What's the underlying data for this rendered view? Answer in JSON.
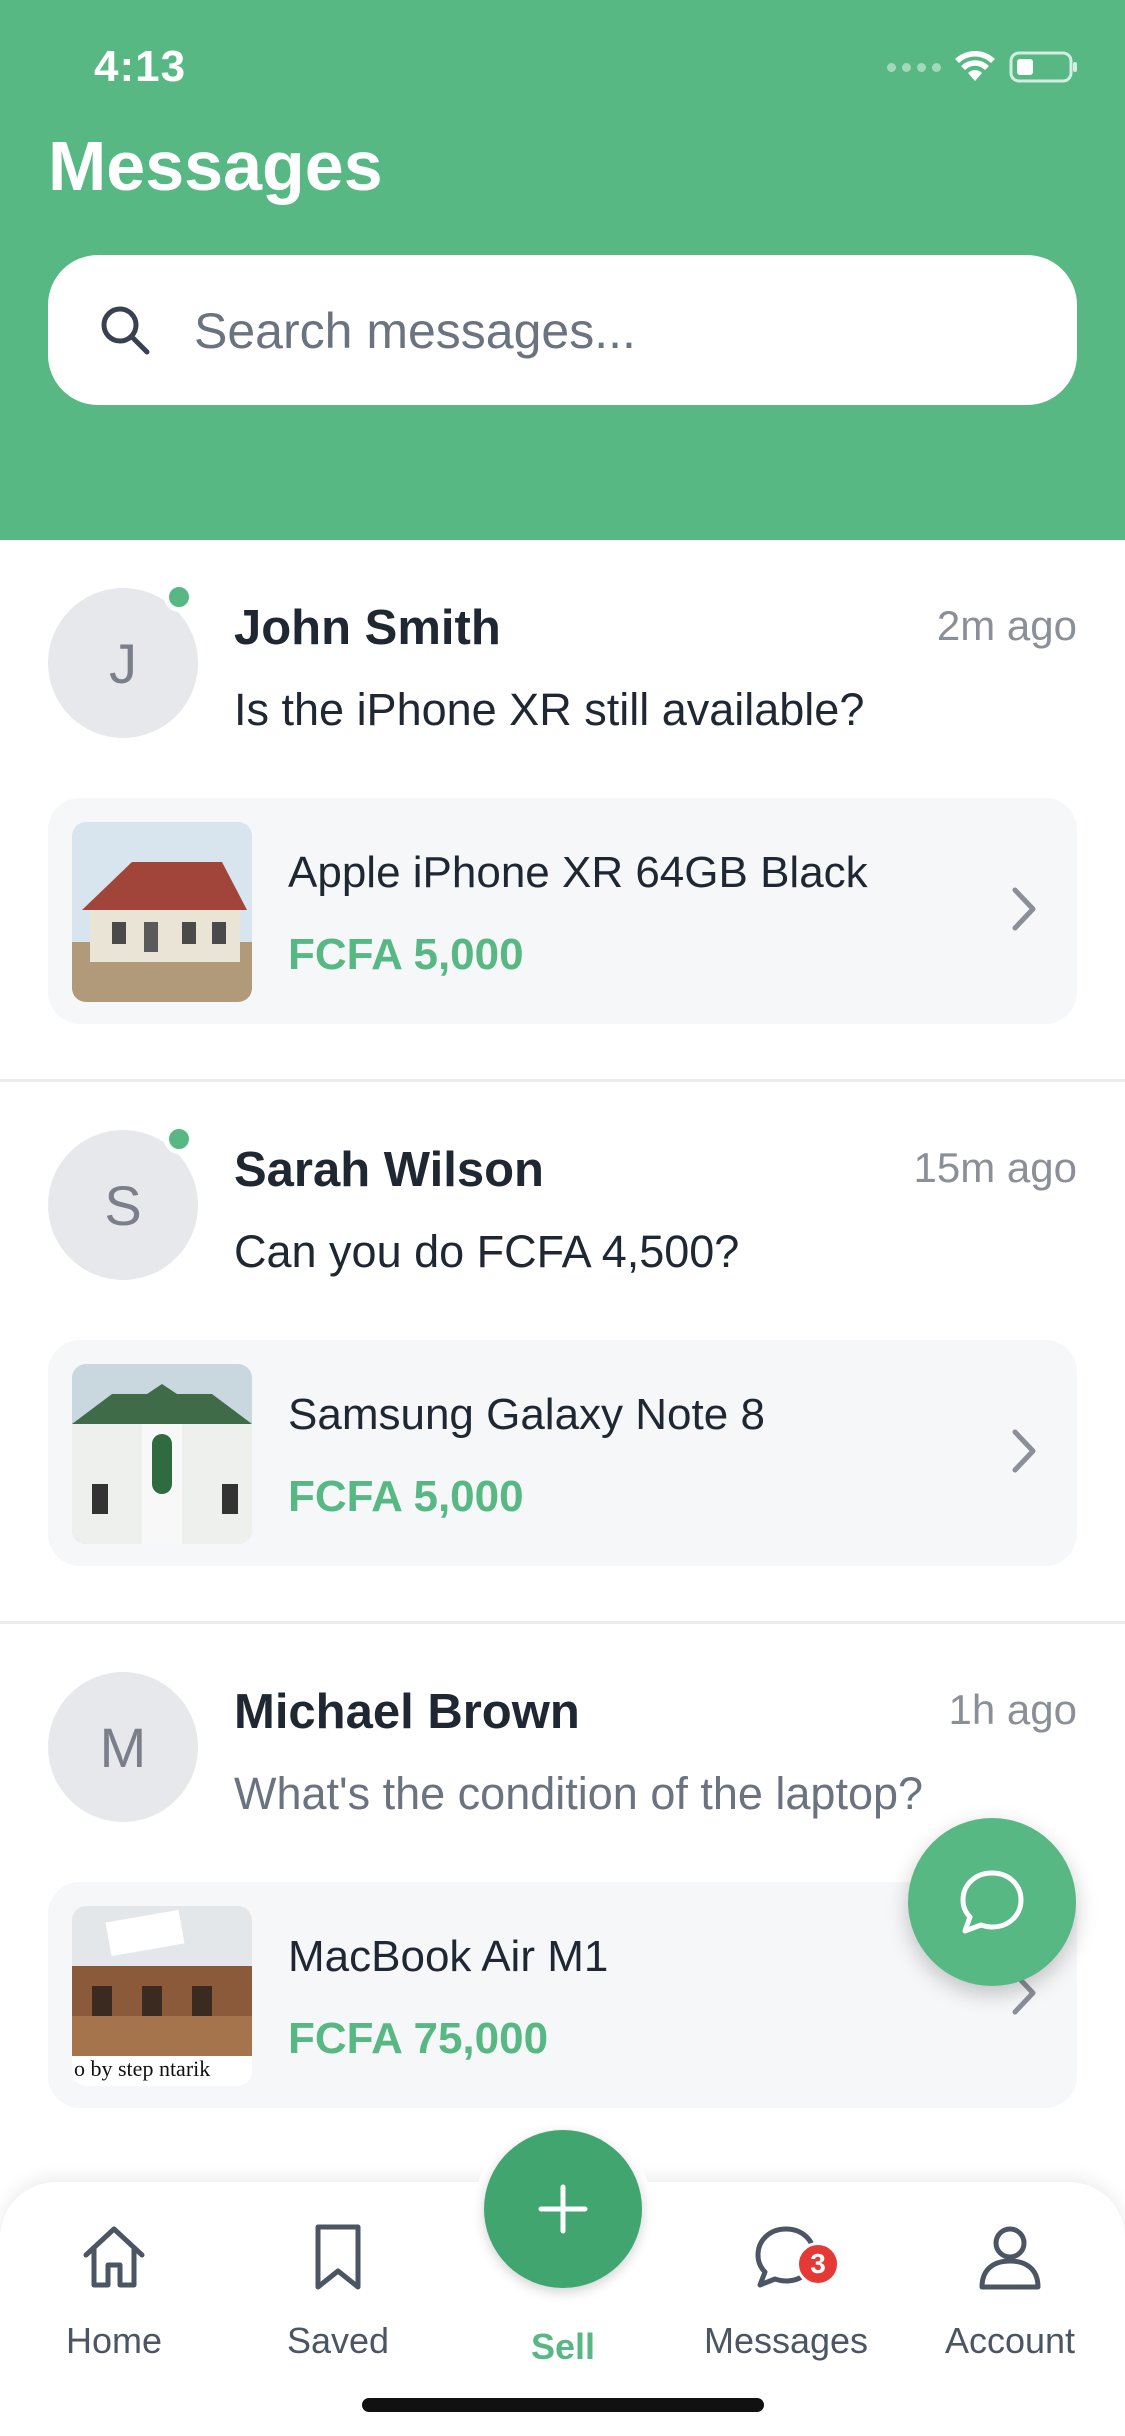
{
  "status_bar": {
    "time": "4:13"
  },
  "header": {
    "title": "Messages"
  },
  "search": {
    "placeholder": "Search messages..."
  },
  "conversations": [
    {
      "initial": "J",
      "name": "John Smith",
      "time": "2m ago",
      "online": true,
      "message": "Is the iPhone XR still available?",
      "listing": {
        "title": "Apple iPhone XR 64GB Black",
        "price": "FCFA 5,000"
      }
    },
    {
      "initial": "S",
      "name": "Sarah Wilson",
      "time": "15m ago",
      "online": true,
      "message": "Can you do FCFA 4,500?",
      "listing": {
        "title": "Samsung Galaxy Note 8",
        "price": "FCFA 5,000"
      }
    },
    {
      "initial": "M",
      "name": "Michael Brown",
      "time": "1h ago",
      "online": false,
      "message": "What's the condition of the laptop?",
      "listing": {
        "title": "MacBook Air M1",
        "price": "FCFA 75,000",
        "thumb_caption": "o by step ntarik"
      }
    }
  ],
  "nav": {
    "home": "Home",
    "saved": "Saved",
    "sell": "Sell",
    "messages": "Messages",
    "messages_badge": "3",
    "account": "Account"
  },
  "colors": {
    "brand_green": "#58b884",
    "badge_red": "#e53935",
    "text_dark": "#1f2733",
    "text_muted": "#8a8f98"
  },
  "icons": [
    "search-icon",
    "chevron-right-icon",
    "chat-bubble-icon",
    "home-icon",
    "bookmark-icon",
    "plus-icon",
    "messages-icon",
    "user-icon",
    "wifi-icon",
    "battery-icon"
  ]
}
